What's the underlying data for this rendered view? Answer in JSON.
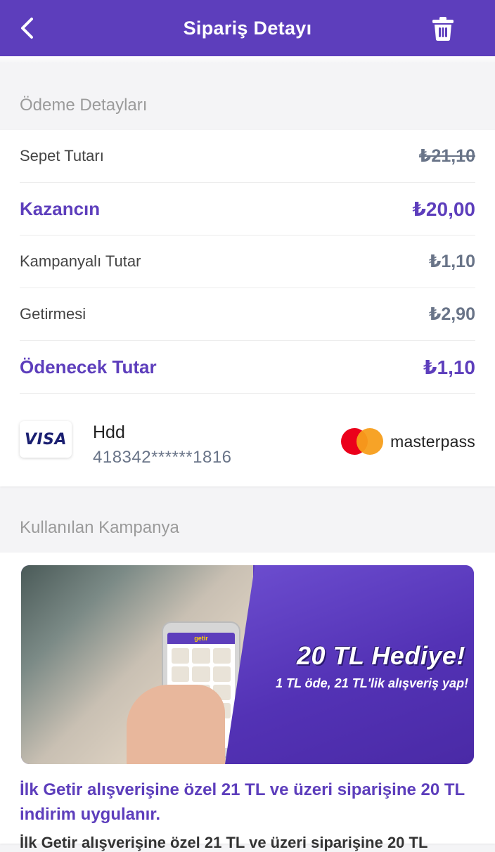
{
  "header": {
    "title": "Sipariş Detayı"
  },
  "payment_section": {
    "title": "Ödeme Detayları",
    "rows": [
      {
        "label": "Sepet Tutarı",
        "value": "₺21,10"
      },
      {
        "label": "Kazancın",
        "value": "₺20,00"
      },
      {
        "label": "Kampanyalı Tutar",
        "value": "₺1,10"
      },
      {
        "label": "Getirmesi",
        "value": "₺2,90"
      },
      {
        "label": "Ödenecek Tutar",
        "value": "₺1,10"
      }
    ],
    "card": {
      "brand": "VISA",
      "name": "Hdd",
      "number": "418342******1816"
    },
    "masterpass": "masterpass"
  },
  "campaign_section": {
    "title": "Kullanılan Kampanya",
    "banner": {
      "app_name": "getir",
      "headline": "20 TL Hediye!",
      "subline": "1 TL öde, 21 TL'lik alışveriş yap!"
    },
    "description": "İlk Getir alışverişine özel 21 TL ve üzeri siparişine 20 TL indirim uygulanır.",
    "description_cut": "İlk Getir alışverişine özel 21 TL ve üzeri siparişine 20 TL"
  },
  "colors": {
    "brand": "#5d3ebc",
    "accent": "#ffd300"
  }
}
